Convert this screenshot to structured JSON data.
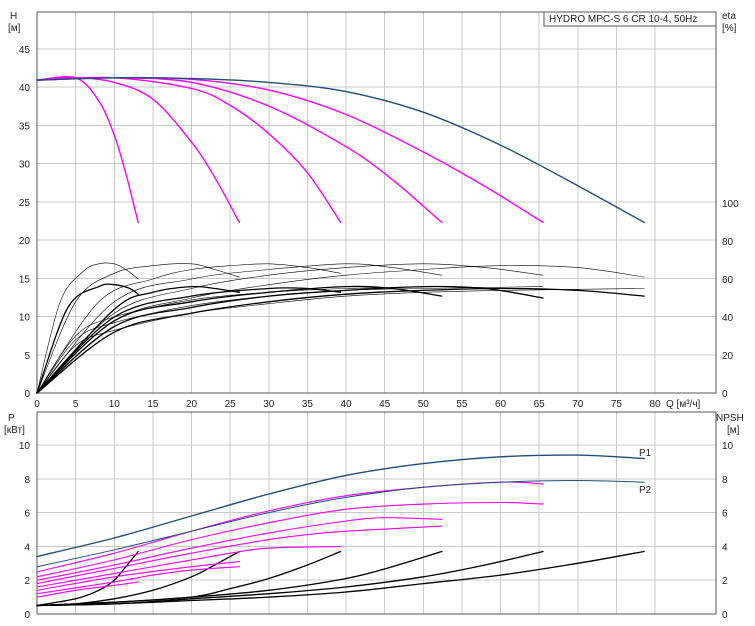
{
  "chart_data": [
    {
      "type": "line",
      "title": "HYDRO MPC-S 6 CR 10-4, 50Hz",
      "xlabel": "Q [м³/ч]",
      "ylabel": "H",
      "ylabel_unit": "[м]",
      "y2label": "eta",
      "y2label_unit": "[%]",
      "xlim": [
        0,
        80
      ],
      "ylim": [
        0,
        50
      ],
      "y2lim": [
        0,
        130
      ],
      "xticks": [
        "0",
        "5",
        "10",
        "15",
        "20",
        "25",
        "30",
        "35",
        "40",
        "45",
        "50",
        "55",
        "60",
        "65",
        "70",
        "75",
        "80"
      ],
      "yticks": [
        "0",
        "5",
        "10",
        "15",
        "20",
        "25",
        "30",
        "35",
        "40",
        "45"
      ],
      "y2ticks": [
        "0",
        "20",
        "40",
        "60",
        "80",
        "100"
      ],
      "grid": true,
      "colors": {
        "total": "#1f4e79",
        "pump": "#ff00ff",
        "eff_thin": "#000000",
        "eff_bold": "#000000"
      },
      "series": [
        {
          "group": "head_total",
          "x": [
            0,
            10,
            20,
            30,
            40,
            50,
            60,
            70,
            78.6
          ],
          "values": [
            40.9,
            41.2,
            41.1,
            40.6,
            39.4,
            36.7,
            32.4,
            27.1,
            22.3
          ]
        },
        {
          "group": "head_pump",
          "x": [
            0,
            5,
            8,
            10,
            11.5,
            13.1
          ],
          "values": [
            40.9,
            41.2,
            38.2,
            33.7,
            28.7,
            22.3
          ]
        },
        {
          "group": "head_pump",
          "x": [
            0,
            5,
            10,
            15,
            20,
            23,
            26.2
          ],
          "values": [
            40.9,
            41.2,
            40.6,
            38.4,
            32.8,
            28.2,
            22.3
          ]
        },
        {
          "group": "head_pump",
          "x": [
            0,
            10,
            20,
            25,
            30,
            35,
            39.3
          ],
          "values": [
            40.9,
            41.2,
            39.8,
            37.6,
            33.9,
            28.8,
            22.3
          ]
        },
        {
          "group": "head_pump",
          "x": [
            0,
            10,
            20,
            30,
            40,
            46,
            52.4
          ],
          "values": [
            40.9,
            41.2,
            40.6,
            37.5,
            32.2,
            27.9,
            22.3
          ]
        },
        {
          "group": "head_pump",
          "x": [
            0,
            10,
            20,
            30,
            40,
            50,
            58,
            65.5
          ],
          "values": [
            40.9,
            41.2,
            41.0,
            39.6,
            36.4,
            31.5,
            27.0,
            22.3
          ]
        },
        {
          "group": "eta_thin",
          "x": [
            0,
            3,
            6,
            8,
            10,
            11.5,
            13.1
          ],
          "values": [
            0,
            48,
            64,
            68,
            68,
            65,
            60
          ]
        },
        {
          "group": "eta_thin",
          "x": [
            0,
            5,
            10,
            15,
            20,
            23,
            26.2
          ],
          "values": [
            0,
            48,
            63,
            67,
            68,
            65,
            61
          ]
        },
        {
          "group": "eta_thin",
          "x": [
            0,
            8,
            15,
            20,
            25,
            30,
            35,
            39.3
          ],
          "values": [
            0,
            48,
            60,
            65,
            67,
            68,
            66,
            63
          ]
        },
        {
          "group": "eta_thin",
          "x": [
            0,
            10,
            20,
            30,
            40,
            46,
            52.4
          ],
          "values": [
            0,
            48,
            60,
            65,
            68,
            66,
            62
          ]
        },
        {
          "group": "eta_thin",
          "x": [
            0,
            10,
            20,
            30,
            40,
            50,
            58,
            65.5
          ],
          "values": [
            0,
            42,
            55,
            62,
            66,
            68,
            66,
            62
          ]
        },
        {
          "group": "eta_thin",
          "x": [
            0,
            10,
            20,
            30,
            40,
            50,
            60,
            70,
            78.6
          ],
          "values": [
            0,
            38,
            50,
            57,
            62,
            65,
            67,
            66,
            61
          ]
        },
        {
          "group": "eta_thin",
          "x": [
            0,
            5,
            10,
            20,
            30,
            40,
            52.4
          ],
          "values": [
            0,
            30,
            40,
            49,
            53,
            55,
            56
          ]
        },
        {
          "group": "eta_thin",
          "x": [
            0,
            5,
            10,
            20,
            30,
            40,
            50,
            65.5
          ],
          "values": [
            0,
            28,
            37,
            46,
            51,
            54,
            55,
            56
          ]
        },
        {
          "group": "eta_thin",
          "x": [
            0,
            5,
            10,
            20,
            30,
            40,
            50,
            60,
            78.6
          ],
          "values": [
            0,
            25,
            33,
            42,
            47,
            51,
            53,
            54,
            55
          ]
        },
        {
          "group": "eta_bold",
          "x": [
            0,
            4,
            8,
            10,
            12,
            13.1
          ],
          "values": [
            0,
            45,
            56,
            57,
            55,
            52
          ]
        },
        {
          "group": "eta_bold",
          "x": [
            0,
            10,
            15,
            20,
            23,
            26.2
          ],
          "values": [
            0,
            44,
            53,
            56,
            55,
            53
          ]
        },
        {
          "group": "eta_bold",
          "x": [
            0,
            10,
            20,
            30,
            35,
            39.3
          ],
          "values": [
            0,
            40,
            51,
            55,
            55,
            53
          ]
        },
        {
          "group": "eta_bold",
          "x": [
            0,
            10,
            20,
            30,
            40,
            46,
            52.4
          ],
          "values": [
            0,
            38,
            48,
            53,
            56,
            55,
            51
          ]
        },
        {
          "group": "eta_bold",
          "x": [
            0,
            10,
            20,
            30,
            40,
            50,
            58,
            65.5
          ],
          "values": [
            0,
            35,
            45,
            51,
            54,
            56,
            55,
            50
          ]
        },
        {
          "group": "eta_bold",
          "x": [
            0,
            10,
            20,
            30,
            40,
            50,
            60,
            70,
            78.6
          ],
          "values": [
            0,
            32,
            42,
            48,
            52,
            54,
            55,
            54,
            51
          ]
        }
      ]
    },
    {
      "type": "line",
      "xlim": [
        0,
        80
      ],
      "ylabel": "P",
      "ylabel_unit": "[кВт]",
      "y2label": "NPSH",
      "y2label_unit": "[м]",
      "ylim": [
        0,
        11
      ],
      "y2lim": [
        0,
        11
      ],
      "yticks": [
        "0",
        "2",
        "4",
        "6",
        "8",
        "10"
      ],
      "y2ticks": [
        "0",
        "2",
        "4",
        "6",
        "8",
        "10"
      ],
      "grid": true,
      "labels": {
        "p1": "P1",
        "p2": "P2"
      },
      "colors": {
        "p1": "#1f4e79",
        "p2": "#1f4e79",
        "pump_power": "#ff00ff",
        "npsh": "#000000"
      },
      "series": [
        {
          "name": "P1",
          "group": "p1",
          "x": [
            0,
            10,
            20,
            30,
            40,
            50,
            60,
            70,
            78.6
          ],
          "values": [
            3.4,
            4.5,
            5.8,
            7.1,
            8.2,
            8.9,
            9.3,
            9.4,
            9.2
          ]
        },
        {
          "name": "P2",
          "group": "p2",
          "x": [
            0,
            10,
            20,
            30,
            40,
            50,
            60,
            70,
            78.6
          ],
          "values": [
            2.8,
            3.8,
            4.9,
            6.0,
            6.9,
            7.5,
            7.8,
            7.9,
            7.8
          ]
        },
        {
          "group": "pump_power",
          "x": [
            0,
            10,
            20,
            30,
            40,
            50,
            60,
            65.5
          ],
          "values": [
            2.5,
            3.6,
            4.9,
            6.1,
            7.0,
            7.5,
            7.8,
            7.7
          ]
        },
        {
          "group": "pump_power",
          "x": [
            0,
            10,
            20,
            30,
            40,
            50,
            60,
            65.5
          ],
          "values": [
            2.2,
            3.2,
            4.4,
            5.4,
            6.2,
            6.5,
            6.6,
            6.5
          ]
        },
        {
          "group": "pump_power",
          "x": [
            0,
            10,
            20,
            30,
            40,
            45,
            52.4
          ],
          "values": [
            2.0,
            2.9,
            3.9,
            4.8,
            5.5,
            5.7,
            5.6
          ]
        },
        {
          "group": "pump_power",
          "x": [
            0,
            10,
            20,
            30,
            35,
            40,
            52.4
          ],
          "values": [
            1.8,
            2.7,
            3.6,
            4.4,
            4.7,
            4.9,
            5.2
          ]
        },
        {
          "group": "pump_power",
          "x": [
            0,
            10,
            20,
            25,
            30,
            39.3
          ],
          "values": [
            1.6,
            2.4,
            3.2,
            3.6,
            3.9,
            4.0
          ]
        },
        {
          "group": "pump_power",
          "x": [
            0,
            10,
            20,
            26.2
          ],
          "values": [
            1.4,
            2.2,
            2.8,
            3.1
          ]
        },
        {
          "group": "pump_power",
          "x": [
            0,
            10,
            15,
            20,
            26.2
          ],
          "values": [
            1.2,
            1.9,
            2.3,
            2.6,
            2.8
          ]
        },
        {
          "group": "pump_power",
          "x": [
            0,
            5,
            10,
            13.1
          ],
          "values": [
            1.0,
            1.4,
            1.7,
            1.9
          ]
        },
        {
          "group": "npsh",
          "x": [
            0,
            5,
            8,
            10,
            11.5,
            13.1
          ],
          "values": [
            0.5,
            0.9,
            1.4,
            2.0,
            2.8,
            3.7
          ]
        },
        {
          "group": "npsh",
          "x": [
            0,
            5,
            10,
            15,
            20,
            23,
            26.2
          ],
          "values": [
            0.5,
            0.6,
            0.9,
            1.4,
            2.2,
            2.9,
            3.7
          ]
        },
        {
          "group": "npsh",
          "x": [
            0,
            10,
            20,
            25,
            30,
            35,
            39.3
          ],
          "values": [
            0.5,
            0.7,
            1.0,
            1.5,
            2.1,
            2.9,
            3.7
          ]
        },
        {
          "group": "npsh",
          "x": [
            0,
            10,
            20,
            30,
            40,
            46,
            52.4
          ],
          "values": [
            0.5,
            0.7,
            1.0,
            1.4,
            2.1,
            2.8,
            3.7
          ]
        },
        {
          "group": "npsh",
          "x": [
            0,
            10,
            20,
            30,
            40,
            50,
            58,
            65.5
          ],
          "values": [
            0.5,
            0.6,
            0.9,
            1.2,
            1.6,
            2.2,
            2.9,
            3.7
          ]
        },
        {
          "group": "npsh",
          "x": [
            0,
            10,
            20,
            30,
            40,
            50,
            60,
            70,
            78.6
          ],
          "values": [
            0.5,
            0.6,
            0.8,
            1.0,
            1.3,
            1.8,
            2.3,
            3.0,
            3.7
          ]
        }
      ]
    }
  ]
}
